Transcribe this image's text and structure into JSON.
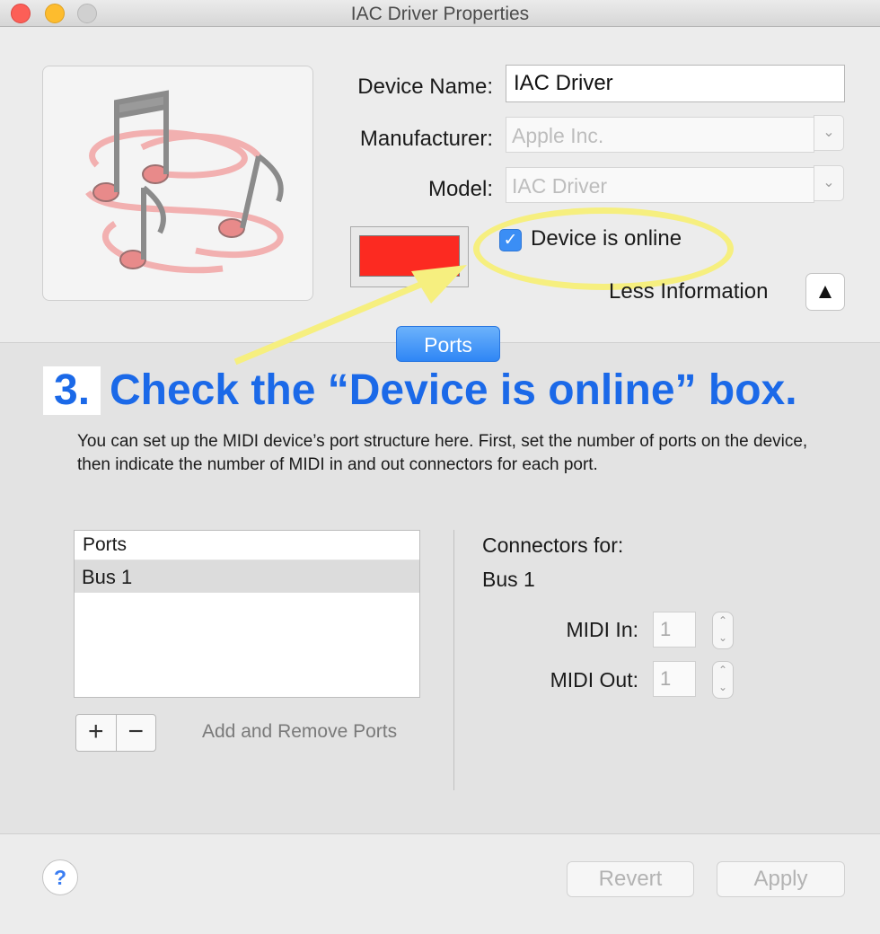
{
  "window": {
    "title": "IAC Driver Properties"
  },
  "device": {
    "name_label": "Device Name:",
    "name_value": "IAC Driver",
    "manufacturer_label": "Manufacturer:",
    "manufacturer_value": "Apple Inc.",
    "model_label": "Model:",
    "model_value": "IAC Driver",
    "color": "#fc2a21",
    "online_label": "Device is online",
    "online_checked": true,
    "less_info_label": "Less Information",
    "disclosure_glyph": "▲"
  },
  "tabs": {
    "ports": "Ports"
  },
  "annotation": {
    "step_number": "3.",
    "step_text": "Check the “Device is online” box.",
    "color": "#1b69e8",
    "highlight_color": "#f6ef7f"
  },
  "ports_panel": {
    "description": "You can set up the MIDI device’s port structure here.  First, set the number of ports on the device, then indicate the number of MIDI in and out connectors for each port.",
    "list_header": "Ports",
    "ports": [
      "Bus 1"
    ],
    "add_glyph": "+",
    "remove_glyph": "−",
    "add_remove_label": "Add and Remove Ports",
    "connectors_title": "Connectors for:",
    "connectors_bus": "Bus 1",
    "midi_in_label": "MIDI In:",
    "midi_in_value": "1",
    "midi_out_label": "MIDI Out:",
    "midi_out_value": "1"
  },
  "footer": {
    "help_glyph": "?",
    "revert_label": "Revert",
    "apply_label": "Apply"
  }
}
